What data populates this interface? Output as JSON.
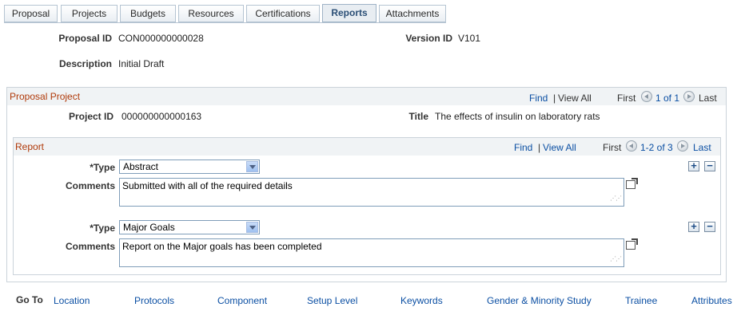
{
  "tabs": [
    "Proposal",
    "Projects",
    "Budgets",
    "Resources",
    "Certifications",
    "Reports",
    "Attachments"
  ],
  "active_tab": "Reports",
  "header": {
    "proposal_id_label": "Proposal ID",
    "proposal_id": "CON000000000028",
    "version_id_label": "Version ID",
    "version_id": "V101",
    "description_label": "Description",
    "description": "Initial Draft"
  },
  "project_box": {
    "title": "Proposal Project",
    "find": "Find",
    "sep": "|",
    "view_all": "View All",
    "first": "First",
    "count": "1 of 1",
    "last": "Last",
    "project_id_label": "Project ID",
    "project_id": "000000000000163",
    "title_label": "Title",
    "title_value": "The effects of insulin on laboratory rats"
  },
  "report_box": {
    "title": "Report",
    "find": "Find",
    "sep": "|",
    "view_all": "View All",
    "first": "First",
    "count": "1-2 of 3",
    "last": "Last",
    "rows": [
      {
        "type_label": "*Type",
        "type": "Abstract",
        "comments_label": "Comments",
        "comments": "Submitted with all of the required details"
      },
      {
        "type_label": "*Type",
        "type": "Major Goals",
        "comments_label": "Comments",
        "comments": "Report on the  Major goals has been completed"
      }
    ]
  },
  "goto": {
    "label": "Go To",
    "links": [
      "Location",
      "Protocols",
      "Component",
      "Setup Level",
      "Keywords",
      "Gender & Minority Study",
      "Trainee",
      "Attributes"
    ]
  },
  "colors": {
    "section_title": "#b03a0a",
    "link": "#0b4fa3",
    "active_tab_text": "#2b4f76"
  }
}
